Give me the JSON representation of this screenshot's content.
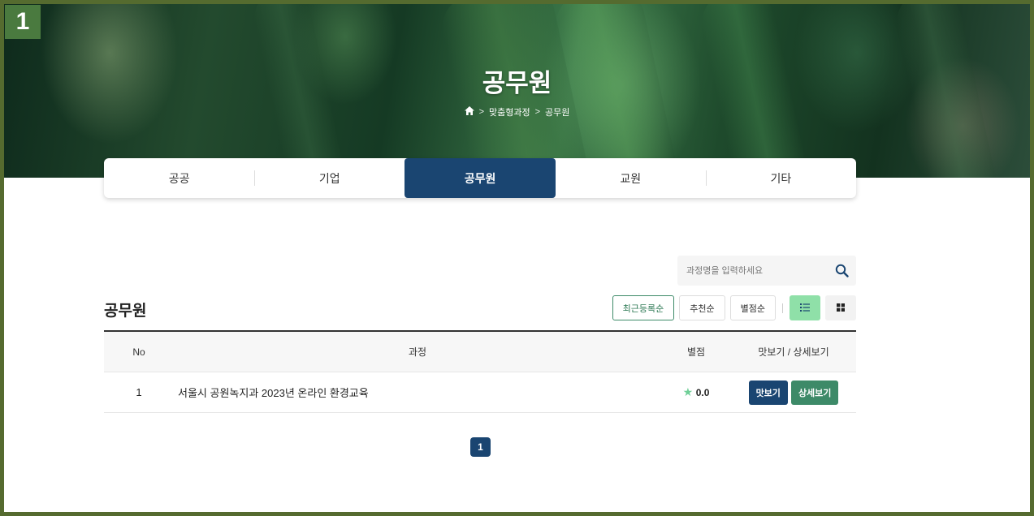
{
  "badge": "1",
  "hero": {
    "title": "공무원",
    "breadcrumb": [
      "맞춤형과정",
      "공무원"
    ]
  },
  "tabs": [
    {
      "label": "공공",
      "active": false
    },
    {
      "label": "기업",
      "active": false
    },
    {
      "label": "공무원",
      "active": true
    },
    {
      "label": "교원",
      "active": false
    },
    {
      "label": "기타",
      "active": false
    }
  ],
  "search": {
    "placeholder": "과정명을 입력하세요",
    "value": ""
  },
  "section_title": "공무원",
  "sort": {
    "options": [
      "최근등록순",
      "추천순",
      "별점순"
    ],
    "active": "최근등록순"
  },
  "view_toggle": {
    "active": "list"
  },
  "table": {
    "headers": {
      "no": "No",
      "title": "과정",
      "rating": "별점",
      "actions": "맛보기 / 상세보기"
    },
    "rows": [
      {
        "no": "1",
        "title": "서울시 공원녹지과 2023년 온라인 환경교육",
        "rating": "0.0",
        "preview": "맛보기",
        "detail": "상세보기"
      }
    ]
  },
  "pagination": {
    "current": "1"
  },
  "colors": {
    "primary": "#1a4571",
    "accent": "#3d8a68",
    "frame": "#556b2f",
    "list_toggle": "#8fe0a8"
  }
}
